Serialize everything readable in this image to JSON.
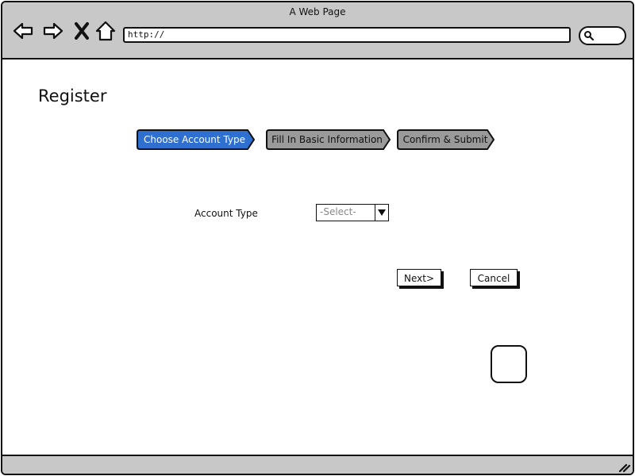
{
  "window": {
    "title": "A Web Page"
  },
  "browser": {
    "address": "http://",
    "nav_icons": [
      "back-arrow-icon",
      "forward-arrow-icon",
      "close-x-icon",
      "home-icon"
    ],
    "search_icon": "search-icon"
  },
  "page": {
    "title": "Register"
  },
  "wizard": {
    "steps": [
      {
        "label": "Choose Account Type",
        "state": "active"
      },
      {
        "label": "Fill In Basic Information",
        "state": "inactive"
      },
      {
        "label": "Confirm & Submit",
        "state": "inactive"
      }
    ]
  },
  "form": {
    "account_type_label": "Account Type",
    "account_type_value": "-Select-"
  },
  "actions": {
    "next_label": "Next>",
    "cancel_label": "Cancel"
  },
  "colors": {
    "active_step": "#2f6fd0",
    "inactive_step": "#9a9a9a",
    "chrome": "#c8c8c8"
  }
}
